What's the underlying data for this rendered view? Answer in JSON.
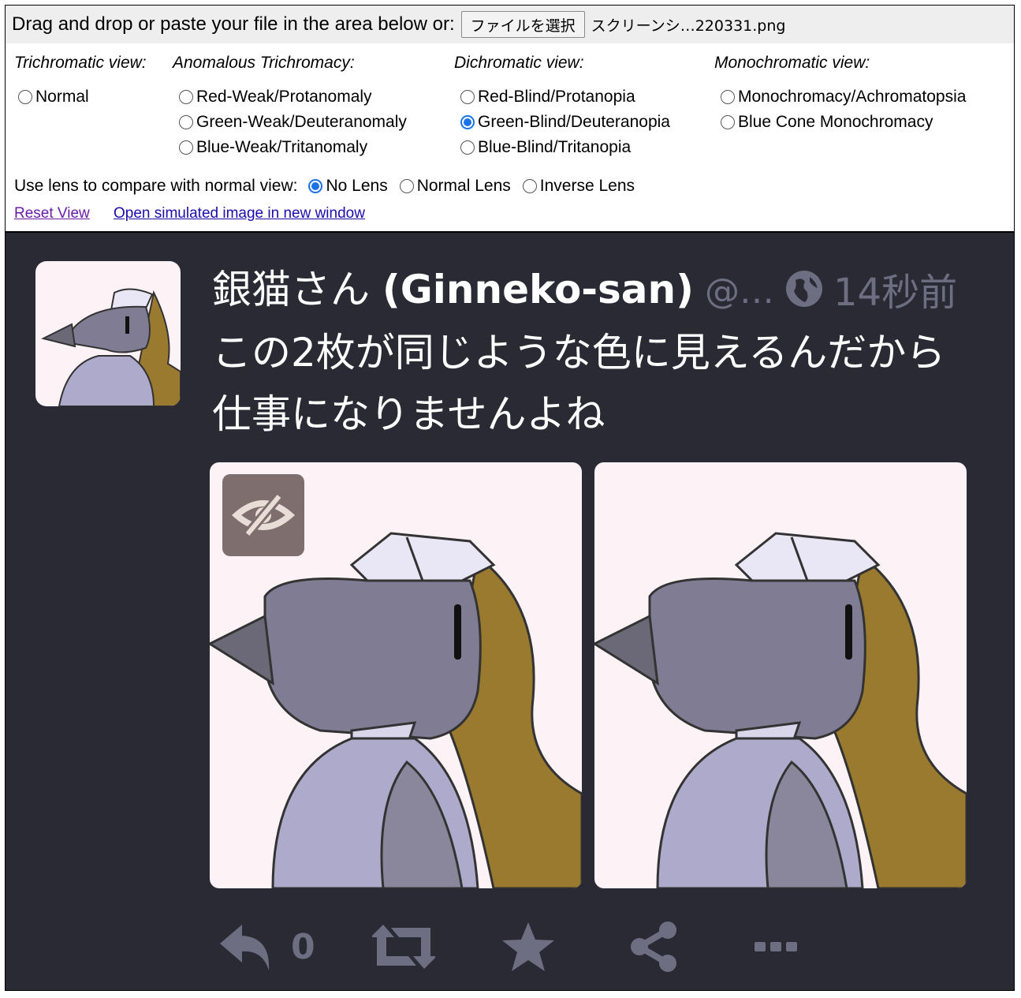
{
  "upload": {
    "label": "Drag and drop or paste your file in the area below or:",
    "button": "ファイルを選択",
    "filename": "スクリーンシ…220331.png"
  },
  "groups": {
    "trichromatic": {
      "header": "Trichromatic view:",
      "options": [
        "Normal"
      ]
    },
    "anomalous": {
      "header": "Anomalous Trichromacy:",
      "options": [
        "Red-Weak/Protanomaly",
        "Green-Weak/Deuteranomaly",
        "Blue-Weak/Tritanomaly"
      ]
    },
    "dichromatic": {
      "header": "Dichromatic view:",
      "options": [
        "Red-Blind/Protanopia",
        "Green-Blind/Deuteranopia",
        "Blue-Blind/Tritanopia"
      ]
    },
    "monochromatic": {
      "header": "Monochromatic view:",
      "options": [
        "Monochromacy/Achromatopsia",
        "Blue Cone Monochromacy"
      ]
    }
  },
  "selected_view": "Green-Blind/Deuteranopia",
  "lens": {
    "label": "Use lens to compare with normal view:",
    "options": [
      "No Lens",
      "Normal Lens",
      "Inverse Lens"
    ],
    "selected": "No Lens"
  },
  "links": {
    "reset": "Reset View",
    "open": "Open simulated image in new window"
  },
  "post": {
    "display_name_jp": "銀猫さん",
    "display_name_en": "(Ginneko-san)",
    "handle": "@…",
    "time": "14秒前",
    "text_line1": "この2枚が同じような色に見えるんだから",
    "text_line2": "仕事になりませんよね",
    "reply_count": "0"
  },
  "colors": {
    "dark_bg": "#2a2a35",
    "muted": "#6e6e82",
    "image_bg": "#fdf2f5",
    "accent": "#1a73e8"
  },
  "icons": [
    "globe-icon",
    "eye-slash-icon",
    "reply-icon",
    "boost-icon",
    "star-icon",
    "share-icon",
    "more-icon"
  ]
}
